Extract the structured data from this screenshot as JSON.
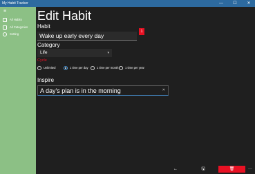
{
  "window": {
    "title": "My Habit Tracker",
    "minimize_icon": "—",
    "maximize_icon": "☐",
    "close_icon": "✕"
  },
  "sidebar": {
    "menu_icon": "≡",
    "items": [
      {
        "label": "All Habits",
        "icon": "habits-icon"
      },
      {
        "label": "All Categories",
        "icon": "categories-icon"
      },
      {
        "label": "Setting",
        "icon": "gear-icon"
      }
    ]
  },
  "main": {
    "heading": "Edit Habit",
    "habit_label": "Habit",
    "habit_value": "Wake up early every day",
    "badge": "1",
    "category_label": "Category",
    "category_value": "Life",
    "cycle_label": "Cycle",
    "cycle_options": [
      "Unlimited",
      "1 time per day",
      "1 time per month",
      "1 time per year"
    ],
    "cycle_selected": "1 time per day",
    "inspire_label": "Inspire",
    "inspire_value": "A day's plan is in the morning"
  },
  "bottombar": {
    "back_icon": "←",
    "save_icon": "🖫",
    "delete_icon": "🗑",
    "more_icon": "···"
  },
  "colors": {
    "titlebar": "#2d6a9f",
    "sidebar": "#8cc085",
    "accent_red": "#e81123",
    "accent_blue": "#4a9be0"
  }
}
